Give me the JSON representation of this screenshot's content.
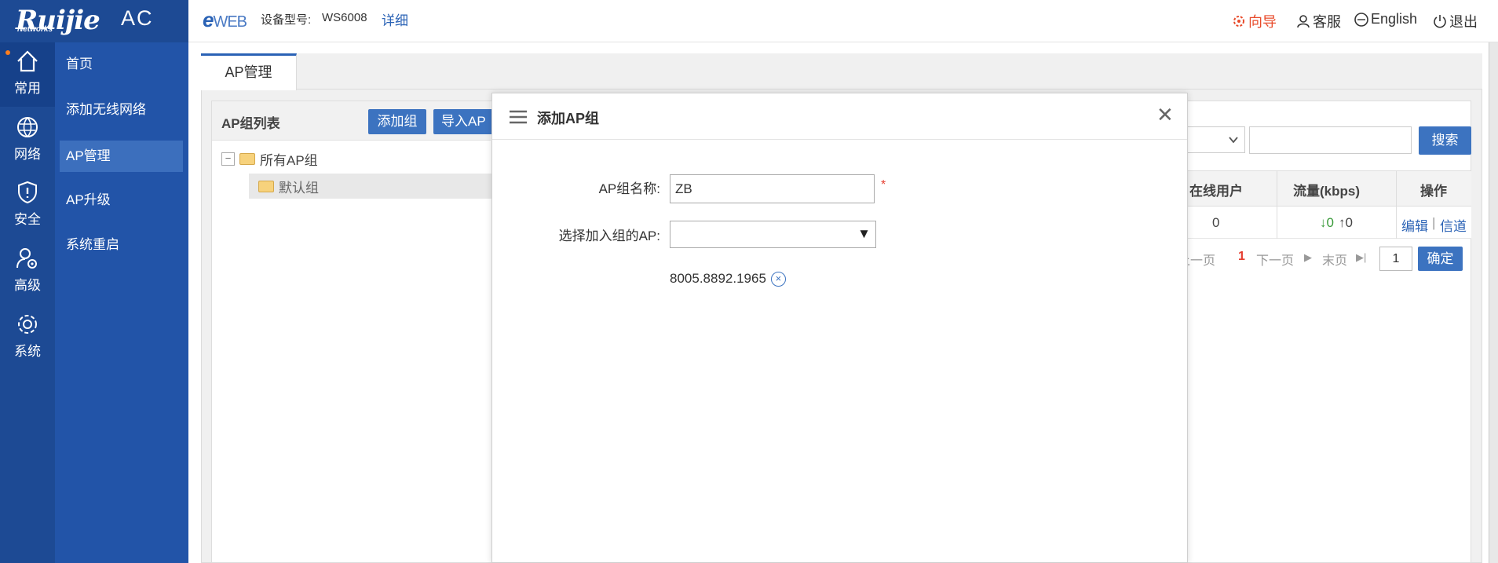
{
  "logo": {
    "brand": "Ruijie",
    "sub": "Networks",
    "product": "AC"
  },
  "rail": [
    {
      "label": "常用",
      "icon": "home-icon"
    },
    {
      "label": "网络",
      "icon": "globe-icon"
    },
    {
      "label": "安全",
      "icon": "shield-icon"
    },
    {
      "label": "高级",
      "icon": "user-gear-icon"
    },
    {
      "label": "系统",
      "icon": "gear-icon"
    }
  ],
  "submenu": [
    {
      "label": "首页"
    },
    {
      "label": "添加无线网络"
    },
    {
      "label": "AP管理"
    },
    {
      "label": "AP升级"
    },
    {
      "label": "系统重启"
    }
  ],
  "header": {
    "eweb_e": "e",
    "eweb_rest": "WEB",
    "device_label": "设备型号:",
    "device_model": "WS6008",
    "detail": "详细",
    "guide": "向导",
    "service": "客服",
    "language": "English",
    "logout": "退出"
  },
  "tab": {
    "label": "AP管理"
  },
  "tree": {
    "title": "AP组列表",
    "add_group": "添加组",
    "import_ap": "导入AP",
    "root": "所有AP组",
    "toggle": "−",
    "child": "默认组"
  },
  "table": {
    "search_btn": "搜索",
    "headers": [
      "在线用户",
      "流量(kbps)",
      "操作"
    ],
    "row": {
      "online": "0",
      "down": "↓0",
      "up": "↑0",
      "edit": "编辑",
      "sep": "|",
      "channel": "信道"
    },
    "pager": {
      "prev": "上一页",
      "current": "1",
      "next": "下一页",
      "last": "末页",
      "input": "1",
      "confirm": "确定"
    }
  },
  "modal": {
    "title": "添加AP组",
    "close": "✕",
    "name_label": "AP组名称:",
    "name_value": "ZB",
    "required_mark": "*",
    "select_label": "选择加入组的AP:",
    "select_arrow": "▼",
    "selected_ap": "8005.8892.1965",
    "remove": "×"
  },
  "colors": {
    "rail": "#1d4a94",
    "submenu": "#2254a8",
    "accent": "#2a62b5",
    "guide": "#e84a2a"
  }
}
